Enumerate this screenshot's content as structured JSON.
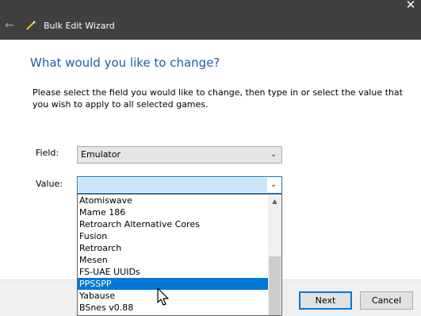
{
  "window": {
    "title": "Bulk Edit Wizard",
    "back_icon": "back-arrow-icon",
    "close_icon": "close-icon"
  },
  "page": {
    "heading": "What would you like to change?",
    "description": "Please select the field you would like to change, then type in or select the value that you wish to apply to all selected games."
  },
  "form": {
    "field_label": "Field:",
    "field_value": "Emulator",
    "value_label": "Value:",
    "value_value": ""
  },
  "dropdown": {
    "options": [
      "Atomiswave",
      "Mame 186",
      "Retroarch Alternative Cores",
      "Fusion",
      "Retroarch",
      "Mesen",
      "FS-UAE UUIDs",
      "PPSSPP",
      "Yabause",
      "BSnes v0.88"
    ],
    "highlighted": "PPSSPP"
  },
  "buttons": {
    "next": "Next",
    "cancel": "Cancel"
  },
  "colors": {
    "accent": "#0078d7",
    "heading": "#1f5fa0",
    "titlebar": "#404040"
  }
}
